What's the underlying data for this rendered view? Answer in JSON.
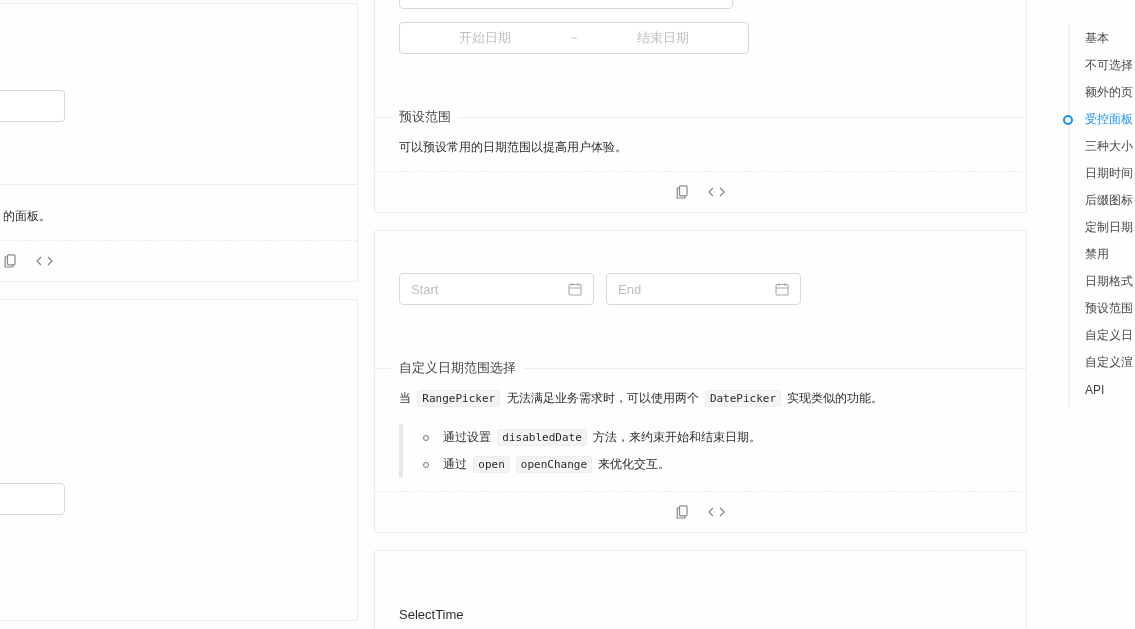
{
  "left_cards": [
    {
      "demo": [
        {
          "kind": "input"
        }
      ],
      "description": [
        {
          "kind": "text",
          "text": "的面板。"
        }
      ],
      "footer": true
    },
    {
      "demo": [
        {
          "kind": "input"
        }
      ],
      "footer": false
    }
  ],
  "right_cards": [
    {
      "demo": [
        {
          "kind": "input"
        },
        {
          "kind": "range",
          "start_placeholder": "开始日期",
          "separator": "~",
          "end_placeholder": "结束日期"
        }
      ],
      "title": "预设范围",
      "description": [
        {
          "kind": "text",
          "text": "可以预设常用的日期范围以提高用户体验。"
        }
      ],
      "footer": true
    },
    {
      "demo": [
        {
          "kind": "date_pair",
          "pickers": [
            {
              "placeholder": "Start"
            },
            {
              "placeholder": "End"
            }
          ]
        }
      ],
      "title": "自定义日期范围选择",
      "description": [
        {
          "kind": "text",
          "text": "当 "
        },
        {
          "kind": "code",
          "text": "RangePicker"
        },
        {
          "kind": "text",
          "text": " 无法满足业务需求时，可以使用两个 "
        },
        {
          "kind": "code",
          "text": "DatePicker"
        },
        {
          "kind": "text",
          "text": " 实现类似的功能。"
        }
      ],
      "notes": [
        [
          {
            "kind": "text",
            "text": "通过设置 "
          },
          {
            "kind": "code",
            "text": "disabledDate"
          },
          {
            "kind": "text",
            "text": " 方法，来约束开始和结束日期。"
          }
        ],
        [
          {
            "kind": "text",
            "text": "通过 "
          },
          {
            "kind": "code",
            "text": "open"
          },
          {
            "kind": "code",
            "text": "openChange"
          },
          {
            "kind": "text",
            "text": " 来优化交互。"
          }
        ]
      ],
      "footer": true
    },
    {
      "demo": [
        {
          "kind": "label",
          "text": "SelectTime"
        }
      ],
      "footer": false
    }
  ],
  "anchor": [
    {
      "label": "基本",
      "selected": false
    },
    {
      "label": "不可选择",
      "selected": false
    },
    {
      "label": "额外的页",
      "selected": false
    },
    {
      "label": "受控面板",
      "selected": true
    },
    {
      "label": "三种大小",
      "selected": false
    },
    {
      "label": "日期时间",
      "selected": false
    },
    {
      "label": "后缀图标",
      "selected": false
    },
    {
      "label": "定制日期",
      "selected": false
    },
    {
      "label": "禁用",
      "selected": false
    },
    {
      "label": "日期格式",
      "selected": false
    },
    {
      "label": "预设范围",
      "selected": false
    },
    {
      "label": "自定义日",
      "selected": false
    },
    {
      "label": "自定义渲",
      "selected": false
    },
    {
      "label": "API",
      "selected": false
    }
  ]
}
